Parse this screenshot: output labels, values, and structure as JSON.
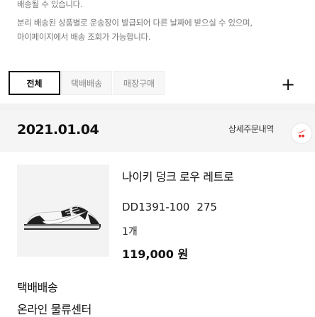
{
  "notice": {
    "lines": [
      "배송될 수 있습니다.",
      "분리 배송된 상품별로 운송장이 발급되어 다른 날짜에 받으실 수 있으며,",
      "마이페이지에서 배송 조회가 가능합니다."
    ]
  },
  "tabs": [
    {
      "label": "전체",
      "active": true
    },
    {
      "label": "택배배송",
      "active": false
    },
    {
      "label": "매장구매",
      "active": false
    }
  ],
  "add_button_label": "+",
  "order": {
    "date": "2021.01.04",
    "detail_link": "상세주문내역",
    "badge_icon": "swoosh-badge-icon"
  },
  "product": {
    "name": "나이키 덩크 로우 레트로",
    "code": "DD1391-100",
    "size": "275",
    "quantity": "1개",
    "price": "119,000 원",
    "image_icon": "sneaker-icon"
  },
  "delivery": {
    "type": "택배배송",
    "center": "온라인 물류센터"
  },
  "colors": {
    "accent": "#111111",
    "muted": "#888888",
    "band": "#f5f5f5"
  }
}
